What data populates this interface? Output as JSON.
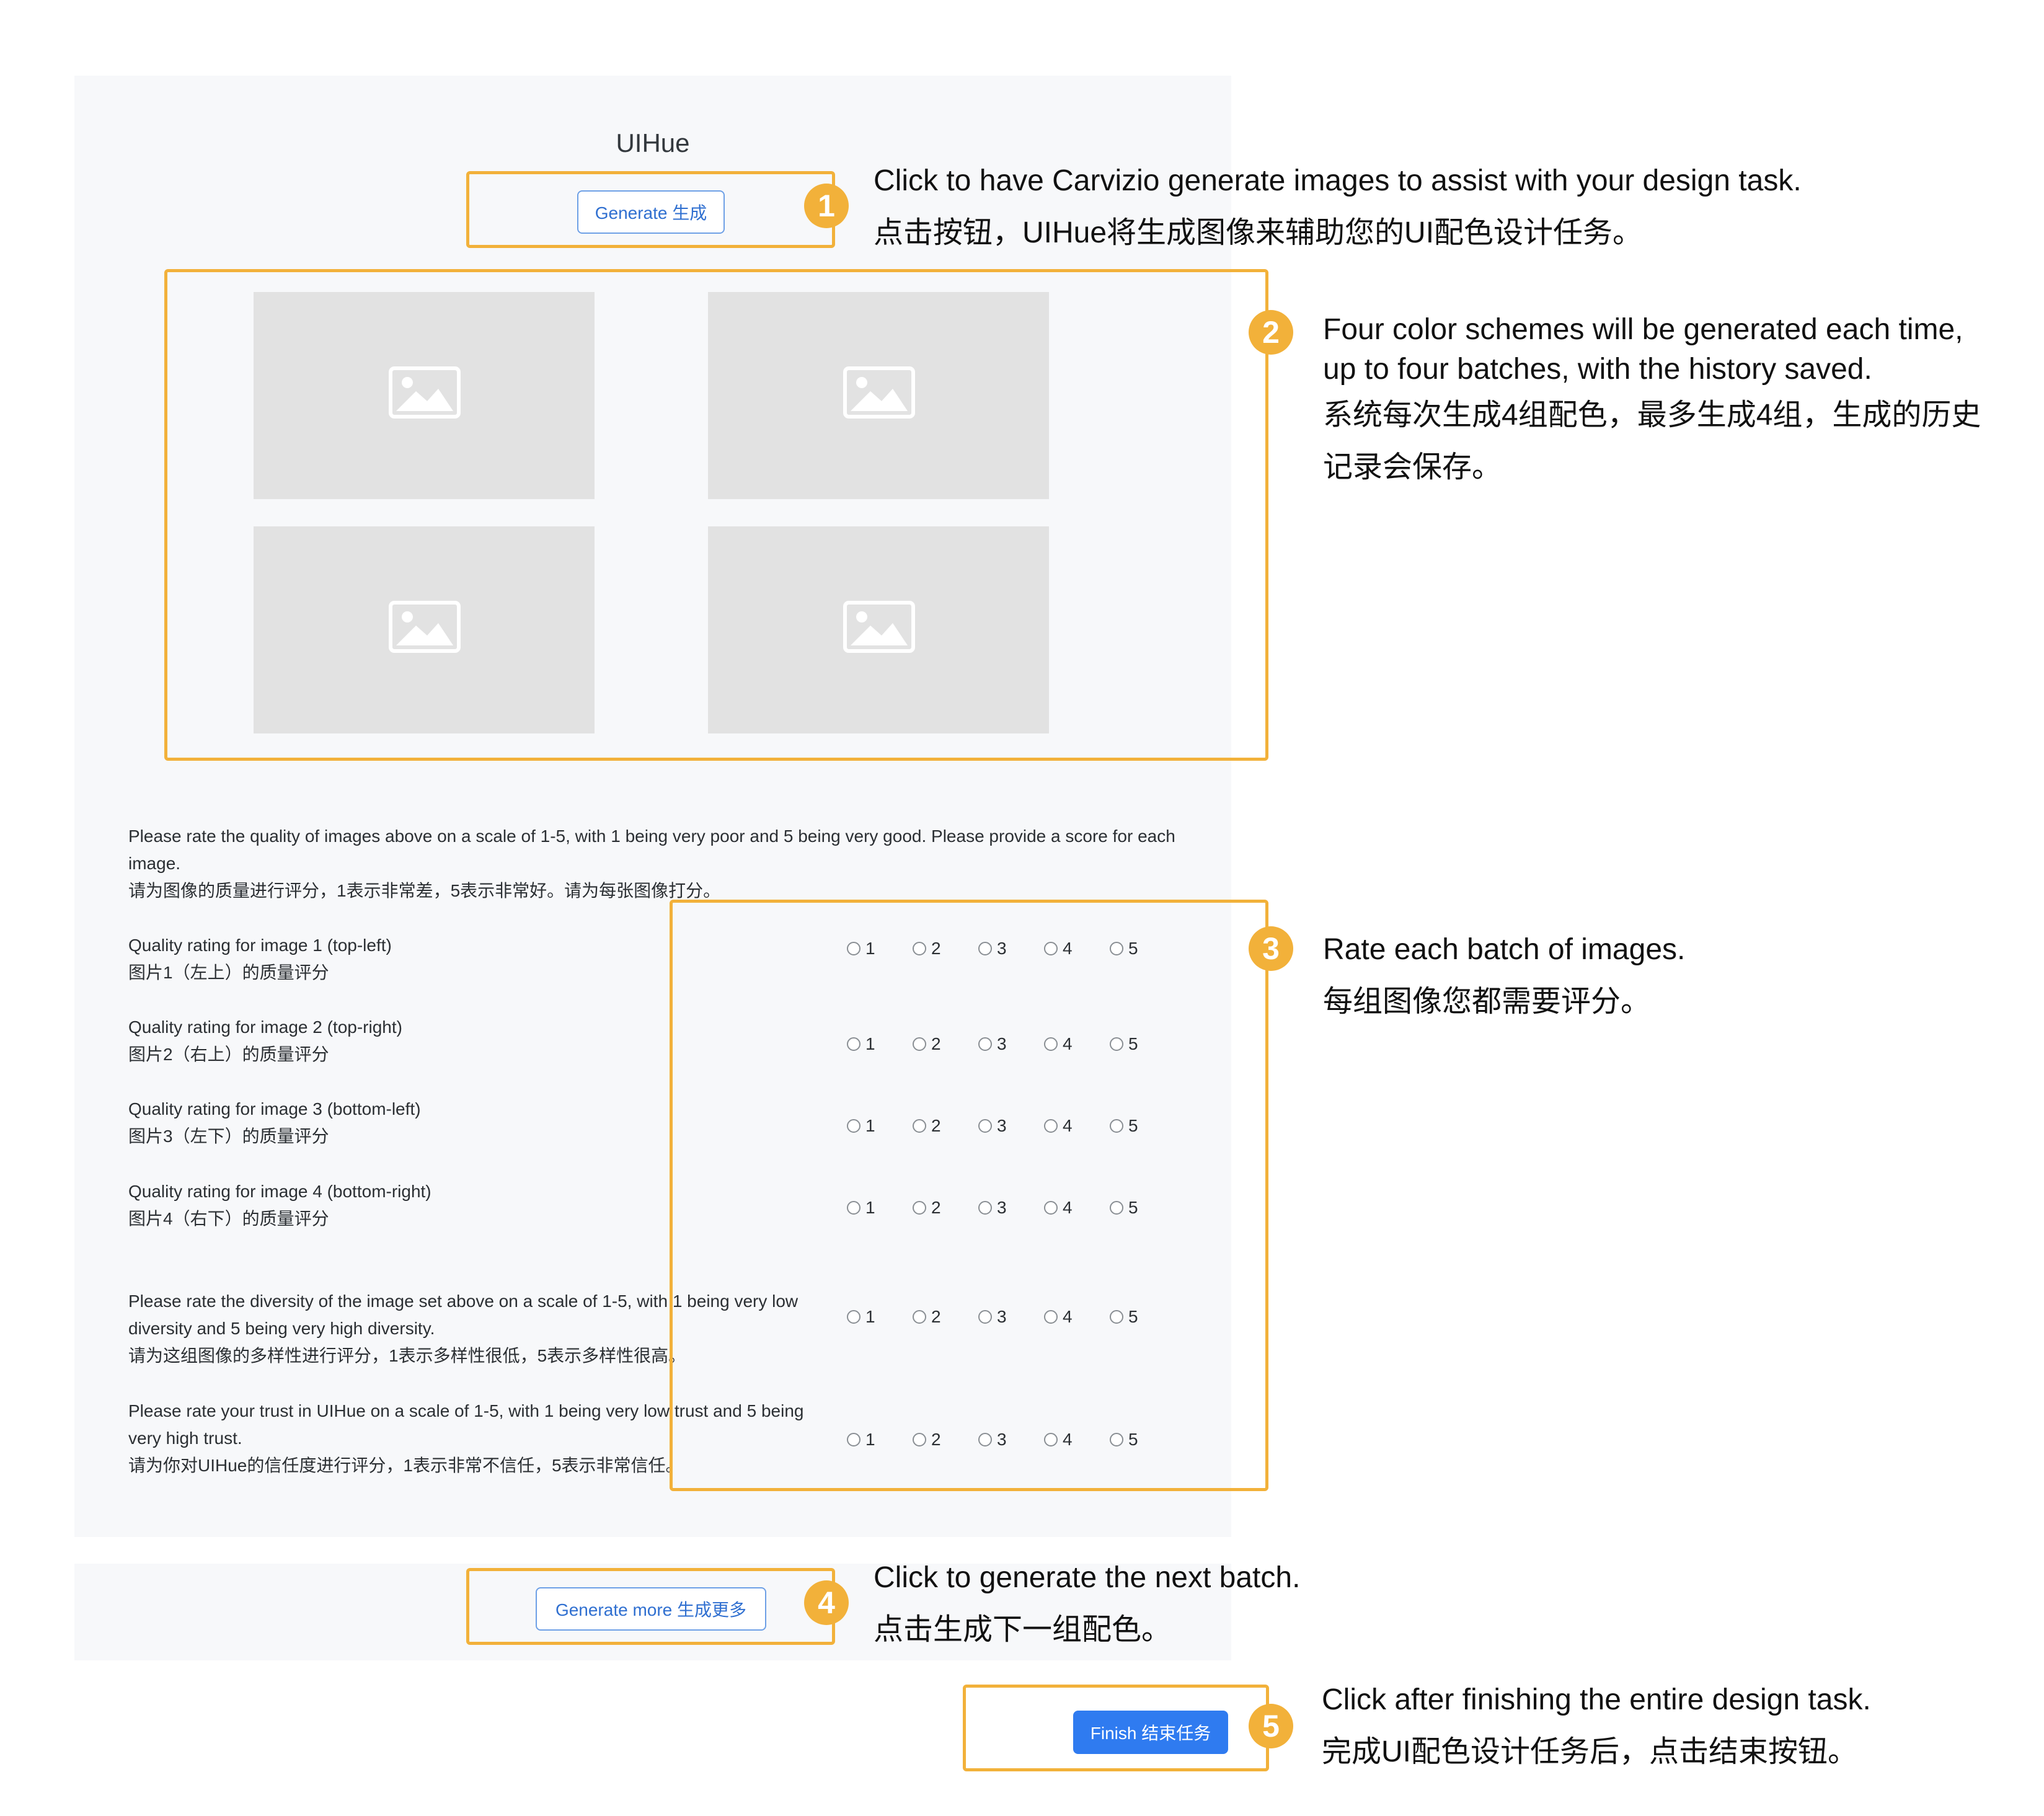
{
  "app_title": "UIHue",
  "buttons": {
    "generate": "Generate 生成",
    "generate_more": "Generate more 生成更多",
    "finish": "Finish 结束任务"
  },
  "annotations": [
    {
      "num": "1",
      "en": "Click to have Carvizio generate images to assist with your design task.",
      "cn": "点击按钮，UIHue将生成图像来辅助您的UI配色设计任务。"
    },
    {
      "num": "2",
      "en": "Four color schemes will be generated each time, up to four batches, with the history saved.",
      "cn": "系统每次生成4组配色，最多生成4组，生成的历史记录会保存。"
    },
    {
      "num": "3",
      "en": "Rate each batch of images.",
      "cn": "每组图像您都需要评分。"
    },
    {
      "num": "4",
      "en": "Click to generate the next batch.",
      "cn": "点击生成下一组配色。"
    },
    {
      "num": "5",
      "en": "Click after finishing the entire design task.",
      "cn": "完成UI配色设计任务后，点击结束按钮。"
    }
  ],
  "images": [
    "image-placeholder-icon",
    "image-placeholder-icon",
    "image-placeholder-icon",
    "image-placeholder-icon"
  ],
  "rating": {
    "intro": {
      "en": "Please rate the quality of images above on a scale of 1-5, with 1 being very poor and 5 being very good. Please provide a score for each image.",
      "cn": "请为图像的质量进行评分，1表示非常差，5表示非常好。请为每张图像打分。"
    },
    "questions": [
      {
        "en": "Quality rating for image 1 (top-left)",
        "cn": "图片1（左上）的质量评分"
      },
      {
        "en": "Quality rating for image 2 (top-right)",
        "cn": "图片2（右上）的质量评分"
      },
      {
        "en": "Quality rating for image 3 (bottom-left)",
        "cn": "图片3（左下）的质量评分"
      },
      {
        "en": "Quality rating for image 4 (bottom-right)",
        "cn": "图片4（右下）的质量评分"
      },
      {
        "en": "Please rate the diversity of the image set above on a scale of 1-5, with 1 being very low diversity and 5 being very high diversity.",
        "cn": "请为这组图像的多样性进行评分，1表示多样性很低，5表示多样性很高。"
      },
      {
        "en": "Please rate your trust in UIHue on a scale of 1-5, with 1 being very low trust and 5 being very high trust.",
        "cn": "请为你对UIHue的信任度进行评分，1表示非常不信任，5表示非常信任。"
      }
    ],
    "options": [
      "1",
      "2",
      "3",
      "4",
      "5"
    ]
  },
  "colors": {
    "highlight": "#f2b13a",
    "panel_bg": "#f7f8fa",
    "button_blue": "#2f7bf0",
    "placeholder_bg": "#e2e2e2"
  }
}
